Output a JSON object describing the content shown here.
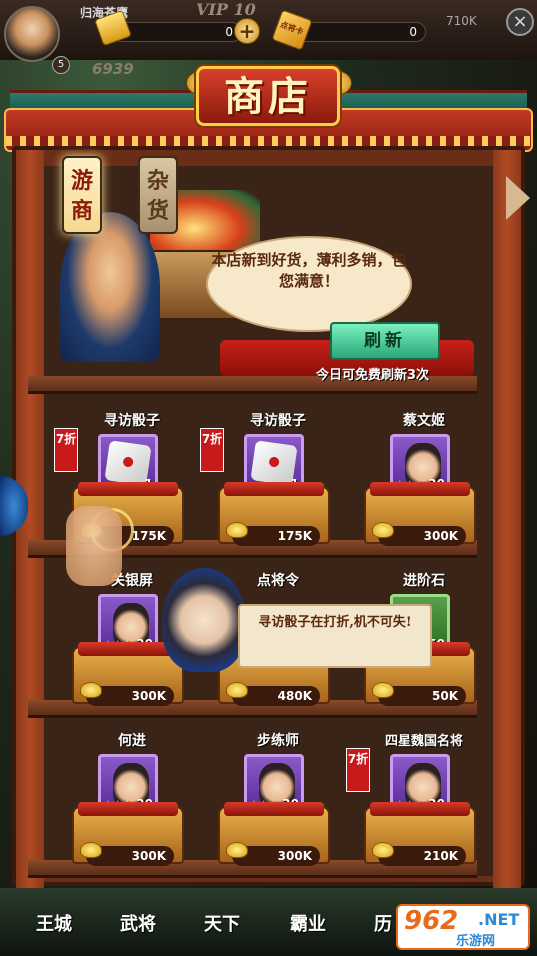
{
  "player": {
    "name": "归海苍鹰",
    "vip": "VIP 10",
    "level": "5",
    "power": "6939"
  },
  "resources": {
    "gold_value": "0",
    "coupon_value": "0",
    "coupon_label": "点将卡",
    "extra_value": "710K",
    "plus_label": "+"
  },
  "header": {
    "shop_title": "商店",
    "close_label": "×"
  },
  "tabs": [
    {
      "label": "游商",
      "active": true
    },
    {
      "label": "杂货",
      "active": false
    }
  ],
  "merchant": {
    "speech": "本店新到好货，薄利多销，包您满意！",
    "refresh_label": "刷新",
    "free_refresh_note": "今日可免费刷新3次"
  },
  "items": [
    {
      "name": "寻访骰子",
      "qty": "1",
      "price": "175K",
      "discount": "7折",
      "stars": ""
    },
    {
      "name": "寻访骰子",
      "qty": "1",
      "price": "175K",
      "discount": "7折",
      "stars": ""
    },
    {
      "name": "蔡文姬",
      "qty": "30",
      "price": "300K",
      "discount": "",
      "stars": "★★★"
    },
    {
      "name": "关银屏",
      "qty": "30",
      "price": "300K",
      "discount": "",
      "stars": "★★★"
    },
    {
      "name": "点将令",
      "qty": "",
      "price": "480K",
      "discount": "",
      "stars": ""
    },
    {
      "name": "进阶石",
      "qty": "50",
      "price": "50K",
      "discount": "",
      "stars": ""
    },
    {
      "name": "何进",
      "qty": "30",
      "price": "300K",
      "discount": "",
      "stars": "★★★"
    },
    {
      "name": "步练师",
      "qty": "30",
      "price": "300K",
      "discount": "",
      "stars": "★★★"
    },
    {
      "name": "四星魏国名将",
      "qty": "30",
      "price": "210K",
      "discount": "7折",
      "stars": "★★★"
    }
  ],
  "tooltip": {
    "text": "寻访骰子在打折,机不可失!"
  },
  "bottom_nav": [
    {
      "label": "王城"
    },
    {
      "label": "武将"
    },
    {
      "label": "天下"
    },
    {
      "label": "霸业"
    },
    {
      "label": "历"
    }
  ],
  "watermark": {
    "number": "962",
    "net": ".NET",
    "site": "乐游网"
  }
}
